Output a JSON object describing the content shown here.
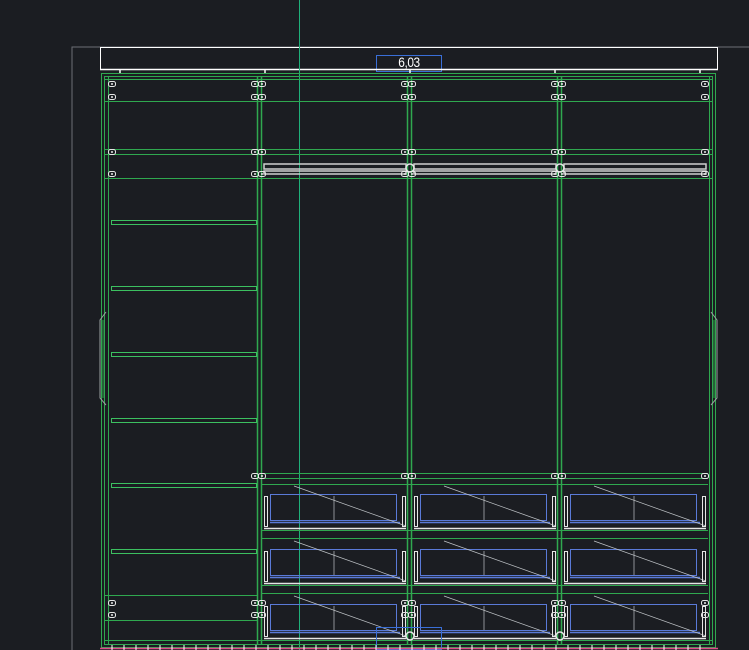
{
  "drawing": {
    "dimension_label": "6,03"
  },
  "colors": {
    "background": "#1b1d22",
    "frame_green": "#2fa84f",
    "thin_green": "#3cc060",
    "crosshair": "#1fb07a",
    "hardware_white": "#e6e6e6",
    "drawer_blue": "#5a7ad8",
    "title_white": "#ffffff",
    "bottom_magenta": "#e04a8a"
  }
}
